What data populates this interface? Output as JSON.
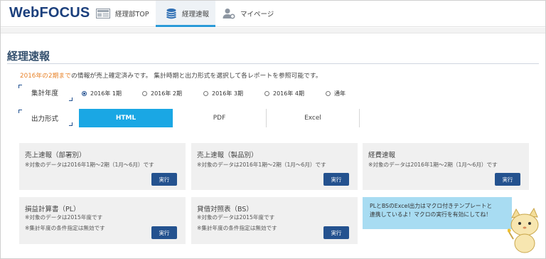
{
  "header": {
    "logo": "WebFOCUS",
    "nav": [
      {
        "label": "経理部TOP",
        "icon": "dashboard-icon"
      },
      {
        "label": "経理速報",
        "icon": "coins-stack-icon",
        "active": true
      },
      {
        "label": "マイページ",
        "icon": "user-gear-icon"
      }
    ]
  },
  "page": {
    "title": "経理速報",
    "intro_highlight": "2016年の2期まで",
    "intro_rest": "の情報が売上確定済みです。 集計時期と出力形式を選択して各レポートを参照可能です。"
  },
  "filters": {
    "period_label": "集計年度",
    "period_options": [
      "2016年 1期",
      "2016年 2期",
      "2016年 3期",
      "2016年 4期",
      "通年"
    ],
    "period_selected": "2016年 1期",
    "format_label": "出力形式",
    "format_options": [
      "HTML",
      "PDF",
      "Excel"
    ],
    "format_selected": "HTML"
  },
  "reports": [
    {
      "title": "売上速報（部署別）",
      "notes": [
        "※対象のデータは2016年1期～2期（1月～6月）です"
      ],
      "button": "実行"
    },
    {
      "title": "売上速報（製品別）",
      "notes": [
        "※対象のデータは2016年1期～2期（1月～6月）です"
      ],
      "button": "実行"
    },
    {
      "title": "経費速報",
      "notes": [
        "※対象のデータは2016年1期～2期（1月～6月）です"
      ],
      "button": "実行"
    },
    {
      "title": "損益計算書（PL）",
      "notes": [
        "※対象のデータは2015年度です",
        "※集計年度の条件指定は無効です"
      ],
      "button": "実行"
    },
    {
      "title": "貸借対照表（BS）",
      "notes": [
        "※対象のデータは2015年度です",
        "※集計年度の条件指定は無効です"
      ],
      "button": "実行"
    }
  ],
  "notice": {
    "line1": "PLとBSのExcel出力はマクロ付きテンプレートと",
    "line2": "連携しているよ！マクロの実行を有効にしてね！"
  },
  "colors": {
    "brand": "#1b3f7c",
    "accent": "#1aa7e4",
    "button": "#24528f",
    "highlight": "#e8832a",
    "notice_bg": "#a8dcf2"
  }
}
